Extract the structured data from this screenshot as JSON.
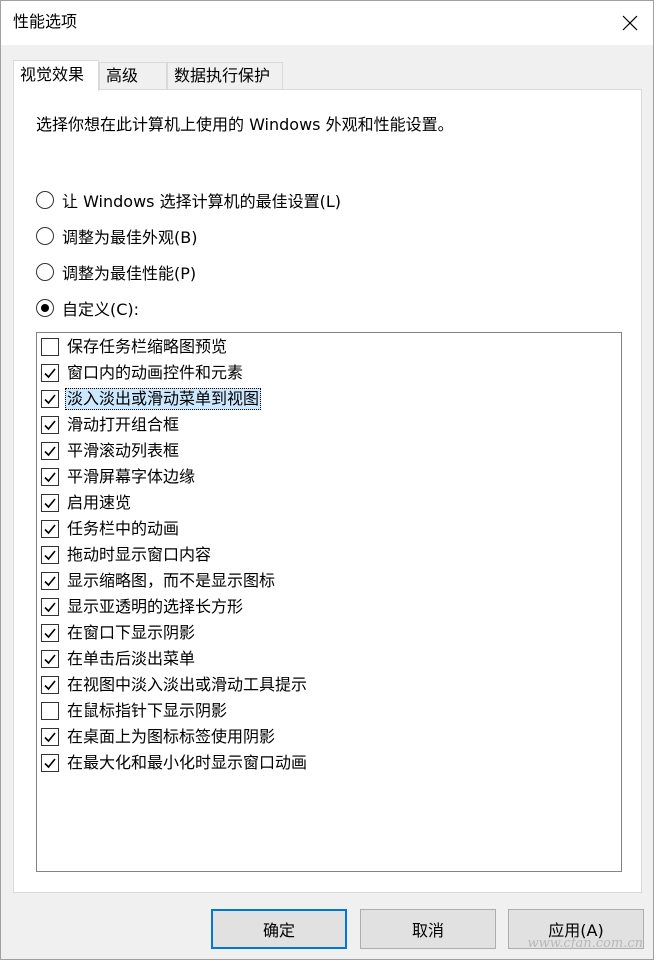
{
  "window": {
    "title": "性能选项"
  },
  "tabs": [
    {
      "label": "视觉效果",
      "active": true
    },
    {
      "label": "高级",
      "active": false
    },
    {
      "label": "数据执行保护",
      "active": false
    }
  ],
  "panel": {
    "description": "选择你想在此计算机上使用的 Windows 外观和性能设置。",
    "radios": [
      {
        "label": "让 Windows 选择计算机的最佳设置(L)",
        "checked": false
      },
      {
        "label": "调整为最佳外观(B)",
        "checked": false
      },
      {
        "label": "调整为最佳性能(P)",
        "checked": false
      },
      {
        "label": "自定义(C):",
        "checked": true
      }
    ],
    "effects": [
      {
        "label": "保存任务栏缩略图预览",
        "checked": false
      },
      {
        "label": "窗口内的动画控件和元素",
        "checked": true
      },
      {
        "label": "淡入淡出或滑动菜单到视图",
        "checked": true,
        "selected": true
      },
      {
        "label": "滑动打开组合框",
        "checked": true
      },
      {
        "label": "平滑滚动列表框",
        "checked": true
      },
      {
        "label": "平滑屏幕字体边缘",
        "checked": true
      },
      {
        "label": "启用速览",
        "checked": true
      },
      {
        "label": "任务栏中的动画",
        "checked": true
      },
      {
        "label": "拖动时显示窗口内容",
        "checked": true
      },
      {
        "label": "显示缩略图，而不是显示图标",
        "checked": true
      },
      {
        "label": "显示亚透明的选择长方形",
        "checked": true
      },
      {
        "label": "在窗口下显示阴影",
        "checked": true
      },
      {
        "label": "在单击后淡出菜单",
        "checked": true
      },
      {
        "label": "在视图中淡入淡出或滑动工具提示",
        "checked": true
      },
      {
        "label": "在鼠标指针下显示阴影",
        "checked": false
      },
      {
        "label": "在桌面上为图标标签使用阴影",
        "checked": true
      },
      {
        "label": "在最大化和最小化时显示窗口动画",
        "checked": true
      }
    ]
  },
  "buttons": {
    "ok": "确定",
    "cancel": "取消",
    "apply": "应用(A)"
  },
  "watermark": "www.cfan.com.cn",
  "colors": {
    "accent": "#0078d7",
    "selection": "#cce8ff",
    "dialog_bg": "#f0f0f0"
  }
}
